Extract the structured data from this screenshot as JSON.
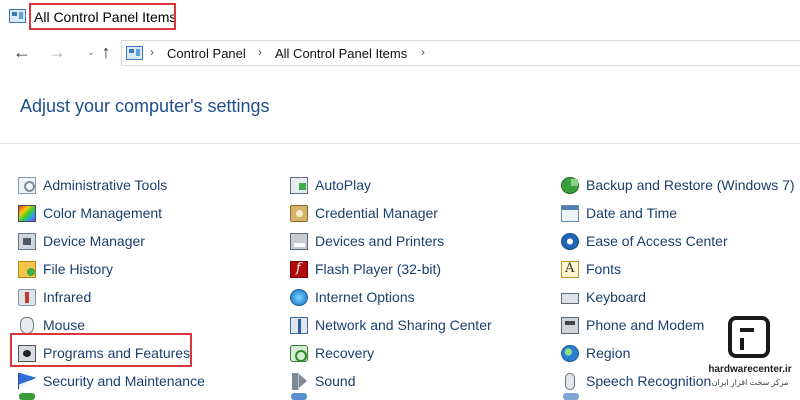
{
  "window": {
    "title": "All Control Panel Items",
    "icon": "control-panel-icon"
  },
  "navigation": {
    "back_icon": "arrow-left-icon",
    "back_glyph": "←",
    "forward_icon": "arrow-right-icon",
    "forward_glyph": "→",
    "recent_icon": "chevron-down-icon",
    "recent_glyph": "⌄",
    "up_icon": "arrow-up-icon",
    "up_glyph": "↑",
    "breadcrumb_separator": "›",
    "breadcrumb": [
      "Control Panel",
      "All Control Panel Items"
    ]
  },
  "main": {
    "heading": "Adjust your computer's settings"
  },
  "items": {
    "column1": [
      {
        "label": "Administrative Tools",
        "icon": "administrative-tools-icon"
      },
      {
        "label": "Color Management",
        "icon": "color-management-icon"
      },
      {
        "label": "Device Manager",
        "icon": "device-manager-icon"
      },
      {
        "label": "File History",
        "icon": "file-history-icon"
      },
      {
        "label": "Infrared",
        "icon": "infrared-icon"
      },
      {
        "label": "Mouse",
        "icon": "mouse-icon"
      },
      {
        "label": "Programs and Features",
        "icon": "programs-features-icon"
      },
      {
        "label": "Security and Maintenance",
        "icon": "security-flag-icon"
      }
    ],
    "column2": [
      {
        "label": "AutoPlay",
        "icon": "autoplay-icon"
      },
      {
        "label": "Credential Manager",
        "icon": "credential-manager-icon"
      },
      {
        "label": "Devices and Printers",
        "icon": "printer-icon"
      },
      {
        "label": "Flash Player (32-bit)",
        "icon": "flash-player-icon"
      },
      {
        "label": "Internet Options",
        "icon": "internet-options-icon"
      },
      {
        "label": "Network and Sharing Center",
        "icon": "network-icon"
      },
      {
        "label": "Recovery",
        "icon": "recovery-icon"
      },
      {
        "label": "Sound",
        "icon": "speaker-icon"
      }
    ],
    "column3": [
      {
        "label": "Backup and Restore (Windows 7)",
        "icon": "backup-restore-icon"
      },
      {
        "label": "Date and Time",
        "icon": "date-time-icon"
      },
      {
        "label": "Ease of Access Center",
        "icon": "ease-of-access-icon"
      },
      {
        "label": "Fonts",
        "icon": "fonts-icon"
      },
      {
        "label": "Keyboard",
        "icon": "keyboard-icon"
      },
      {
        "label": "Phone and Modem",
        "icon": "phone-modem-icon"
      },
      {
        "label": "Region",
        "icon": "region-globe-icon"
      },
      {
        "label": "Speech Recognition",
        "icon": "microphone-icon"
      }
    ]
  },
  "highlight_color": "#d9363e",
  "heading_color": "#1e4e8c",
  "link_color": "#1a3f6f",
  "watermark": {
    "site": "hardwarecenter.ir",
    "tagline": "مرکز سخت افزار ایران",
    "logo_icon": "hardwarecenter-logo-icon"
  }
}
